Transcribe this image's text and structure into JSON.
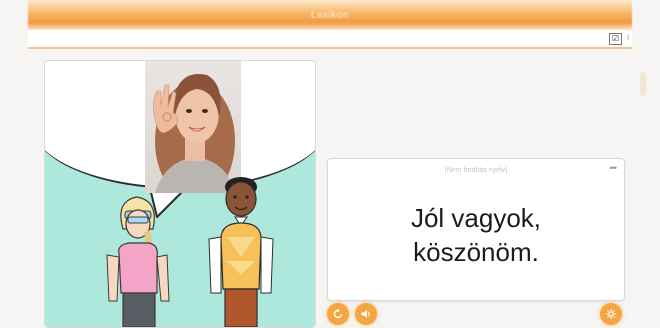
{
  "app": {
    "title": "Lexikon"
  },
  "toolbar": {
    "toggle_glyph": "☑",
    "toggle_extra": "i"
  },
  "card": {
    "header": "[Nem fordítás nyelv]",
    "more_glyph": "•••",
    "phrase_line1": "Jól vagyok,",
    "phrase_line2": "köszönöm."
  },
  "icons": {
    "controls_left": [
      "replay-icon",
      "speaker-icon"
    ],
    "controls_right": [
      "settings-icon"
    ]
  },
  "colors": {
    "accent": "#f4a640",
    "ground": "#aee8dc",
    "bar": "#f19a3e"
  }
}
